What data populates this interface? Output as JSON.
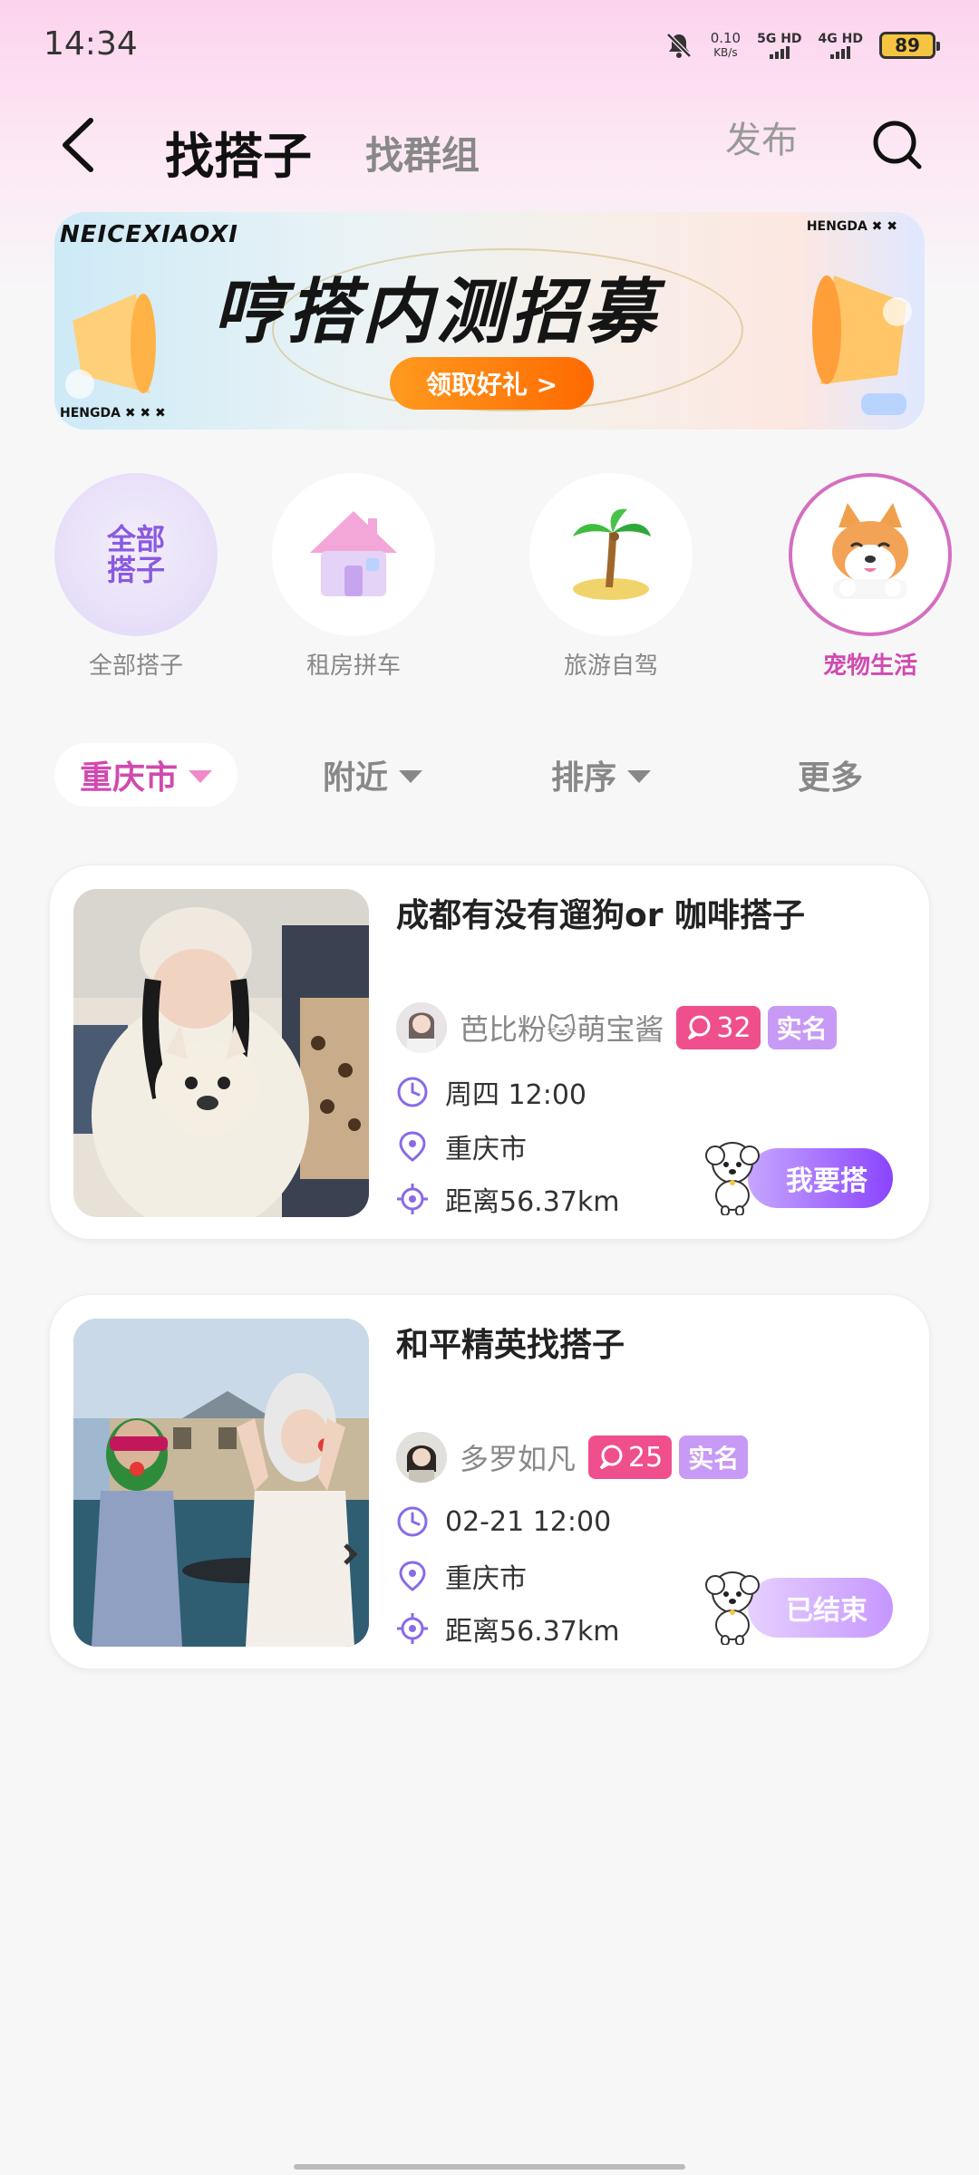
{
  "status_bar": {
    "time": "14:34",
    "net_speed_value": "0.10",
    "net_speed_unit": "KB/s",
    "signal1_label": "5G HD",
    "signal2_label": "4G HD",
    "battery": "89",
    "icons": [
      "mute-bell-icon",
      "signal-icon",
      "battery-icon"
    ]
  },
  "header": {
    "back_icon": "chevron-left-icon",
    "tab_active": "找搭子",
    "tab_inactive": "找群组",
    "publish": "发布",
    "search_icon": "search-icon"
  },
  "banner": {
    "tag_left": "NEICEXIAOXI",
    "tag_right": "HENGDA ✖ ✖",
    "tag_bottom_left": "HENGDA ✖ ✖ ✖",
    "title": "哼搭内测招募",
    "button": "领取好礼 >"
  },
  "categories": [
    {
      "label": "全部搭子",
      "icon_text": "全部搭子",
      "icon": "all-icon",
      "selected": false
    },
    {
      "label": "租房拼车",
      "icon": "house-icon",
      "selected": false
    },
    {
      "label": "旅游自驾",
      "icon": "palm-tree-icon",
      "selected": false
    },
    {
      "label": "宠物生活",
      "icon": "corgi-icon",
      "selected": true
    }
  ],
  "filters": {
    "city": "重庆市",
    "nearby": "附近",
    "sort": "排序",
    "more": "更多"
  },
  "posts": [
    {
      "title": "成都有没有遛狗or 咖啡搭子",
      "username": "芭比粉🐱萌宝酱",
      "comments": "32",
      "verified": "实名",
      "time": "周四 12:00",
      "city": "重庆市",
      "distance": "距离56.37km",
      "button": "我要搭"
    },
    {
      "title": "和平精英找搭子",
      "username": "多罗如凡",
      "comments": "25",
      "verified": "实名",
      "time": "02-21 12:00",
      "city": "重庆市",
      "distance": "距离56.37km",
      "button": "已结束"
    }
  ],
  "colors": {
    "accent_pink": "#d04ab0",
    "accent_purple": "#8a44ff",
    "comment_badge": "#ef4f8d",
    "verified_badge": "#c69af5"
  }
}
